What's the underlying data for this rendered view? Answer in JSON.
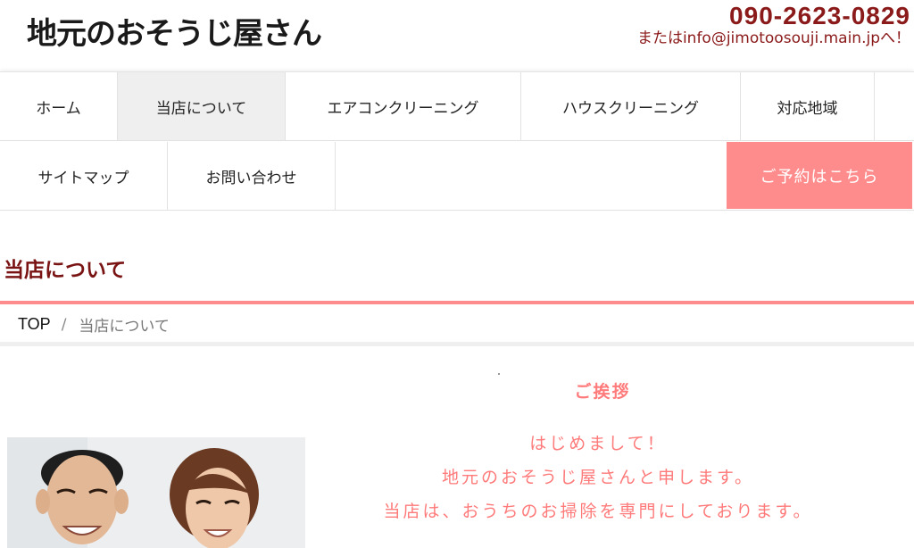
{
  "header": {
    "logo_text": "地元のおそうじ屋さん",
    "phone": "090-2623-0829",
    "email_line": "またはinfo@jimotoosouji.main.jpへ！"
  },
  "nav": {
    "row1": [
      {
        "label": "ホーム",
        "active": false
      },
      {
        "label": "当店について",
        "active": true
      },
      {
        "label": "エアコンクリーニング",
        "active": false
      },
      {
        "label": "ハウスクリーニング",
        "active": false
      },
      {
        "label": "対応地域",
        "active": false
      }
    ],
    "row2": [
      {
        "label": "サイトマップ",
        "active": false
      },
      {
        "label": "お問い合わせ",
        "active": false
      }
    ],
    "reserve_label": "ご予約はこちら"
  },
  "page": {
    "title": "当店について",
    "breadcrumb": {
      "top": "TOP",
      "separator": "/",
      "current": "当店について"
    },
    "greeting": {
      "heading": "ご挨拶",
      "lines": [
        "はじめまして！",
        "地元のおそうじ屋さんと申します。",
        "当店は、おうちのお掃除を専門にしております。"
      ]
    }
  },
  "colors": {
    "accent_pink": "#ff8c8c",
    "brand_red": "#8b1a1a",
    "title_red": "#7a1414",
    "greeting_pink": "#ff7a7a"
  }
}
